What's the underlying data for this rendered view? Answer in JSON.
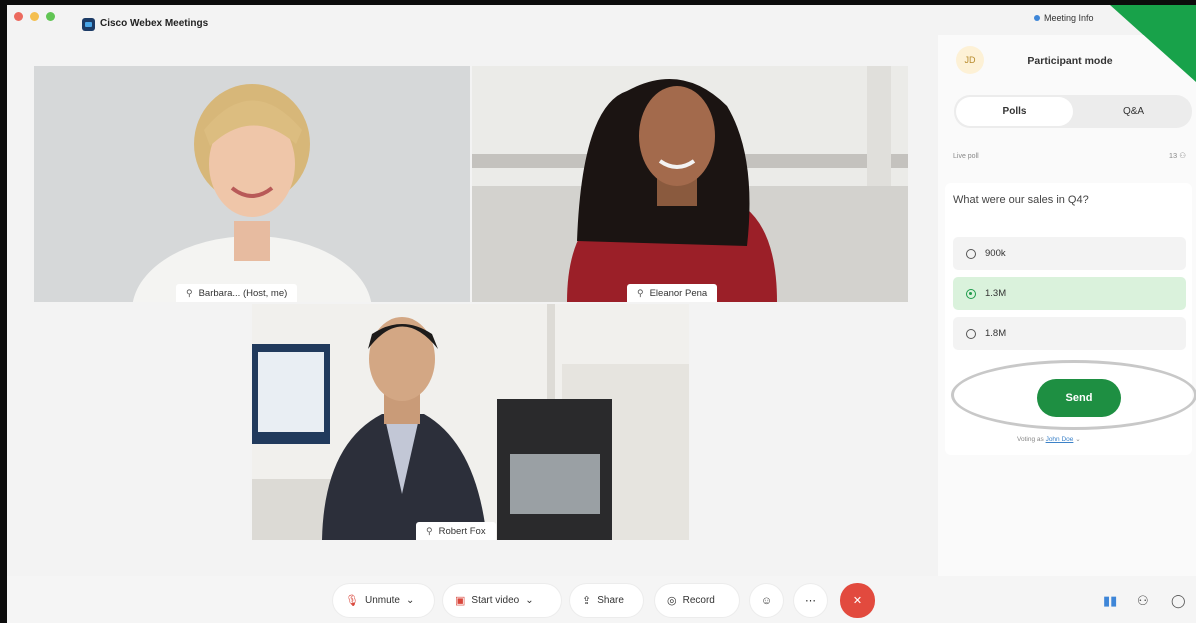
{
  "window": {
    "title": "Cisco Webex Meetings",
    "meeting_info": "Meeting Info",
    "dots": [
      "#ec6a5e",
      "#f4bf4f",
      "#61c554"
    ],
    "corner_color": "#18a24a"
  },
  "videos": [
    {
      "name": "Barbara... (Host, me)"
    },
    {
      "name": "Eleanor Pena"
    },
    {
      "name": "Robert Fox"
    }
  ],
  "panel": {
    "avatar_initials": "JD",
    "mode_title": "Participant mode",
    "tabs": [
      {
        "label": "Polls",
        "active": true
      },
      {
        "label": "Q&A",
        "active": false
      }
    ],
    "poll_type": "Live poll",
    "poll_count": "13",
    "question": "What were our sales in Q4?",
    "options": [
      {
        "label": "900k",
        "selected": false
      },
      {
        "label": "1.3M",
        "selected": true
      },
      {
        "label": "1.8M",
        "selected": false
      }
    ],
    "send_label": "Send",
    "voting_prefix": "Voting as",
    "voting_name": "John Doe",
    "accent": "#1e8f42"
  },
  "toolbar": {
    "unmute": "Unmute",
    "start_video": "Start video",
    "share": "Share",
    "record": "Record",
    "end_color": "#e24a3e"
  }
}
